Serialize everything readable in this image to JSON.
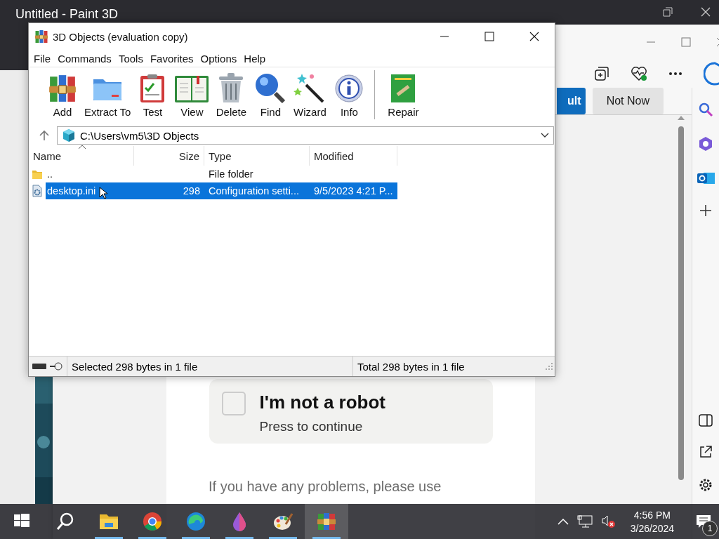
{
  "background_window": {
    "title": "Untitled - Paint 3D"
  },
  "browser": {
    "infobar_buttons": [
      {
        "label": "ult",
        "kind": "primary"
      },
      {
        "label": "Not Now",
        "kind": "secondary"
      }
    ],
    "captcha": {
      "checked": false,
      "title": "I'm not a robot",
      "subtitle": "Press to continue"
    },
    "footer_text": "If you have any problems, please use"
  },
  "winrar": {
    "title": "3D Objects (evaluation copy)",
    "menu": [
      "File",
      "Commands",
      "Tools",
      "Favorites",
      "Options",
      "Help"
    ],
    "toolbar": [
      {
        "label": "Add",
        "kind": "add"
      },
      {
        "label": "Extract To",
        "kind": "extract"
      },
      {
        "label": "Test",
        "kind": "test"
      },
      {
        "label": "View",
        "kind": "view"
      },
      {
        "label": "Delete",
        "kind": "delete"
      },
      {
        "label": "Find",
        "kind": "find"
      },
      {
        "label": "Wizard",
        "kind": "wizard"
      },
      {
        "label": "Info",
        "kind": "info"
      },
      {
        "label": "Repair",
        "kind": "repair"
      }
    ],
    "address": "C:\\Users\\vm5\\3D Objects",
    "columns": [
      "Name",
      "Size",
      "Type",
      "Modified"
    ],
    "rows": [
      {
        "kind": "folder",
        "name": "..",
        "type": "File folder",
        "selected": false
      },
      {
        "kind": "file",
        "name": "desktop.ini",
        "size": "298",
        "type": "Configuration setti...",
        "modified": "9/5/2023 4:21 P...",
        "selected": true
      }
    ],
    "status_left": "Selected 298 bytes in 1 file",
    "status_right": "Total 298 bytes in 1 file"
  },
  "taskbar": {
    "apps": [
      {
        "kind": "start",
        "running": false,
        "selected": false
      },
      {
        "kind": "search",
        "running": false,
        "selected": false
      },
      {
        "kind": "explorer",
        "running": true,
        "selected": false
      },
      {
        "kind": "chrome",
        "running": true,
        "selected": false
      },
      {
        "kind": "edge",
        "running": true,
        "selected": false
      },
      {
        "kind": "drop",
        "running": true,
        "selected": false
      },
      {
        "kind": "paint",
        "running": true,
        "selected": false
      },
      {
        "kind": "winrar",
        "running": true,
        "selected": true
      }
    ],
    "clock": {
      "time": "4:56 PM",
      "date": "3/26/2024"
    },
    "notification_count": "1"
  }
}
